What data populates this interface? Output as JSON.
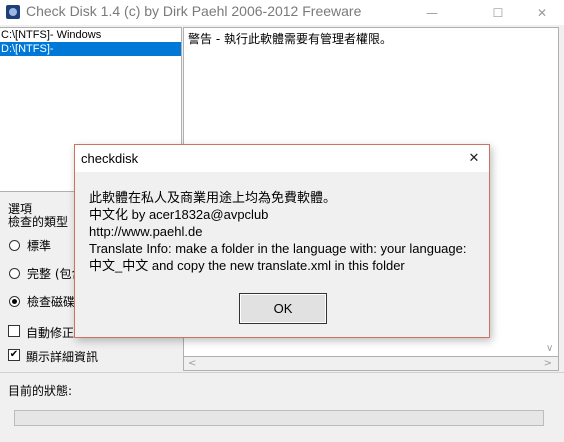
{
  "window": {
    "title": "Check Disk 1.4  (c) by Dirk Paehl  2006-2012 Freeware",
    "minimize_glyph": "—",
    "maximize_glyph": "☐",
    "close_glyph": "✕"
  },
  "drives": [
    {
      "label": "C:\\[NTFS]- Windows",
      "selected": false
    },
    {
      "label": "D:\\[NTFS]-",
      "selected": true
    }
  ],
  "log": {
    "lines": [
      "警告 - 執行此軟體需要有管理者權限。"
    ]
  },
  "options": {
    "title": "選項",
    "subtitle": "檢查的類型",
    "radios": [
      {
        "label": "標準",
        "checked": false
      },
      {
        "label": "完整 (包含",
        "checked": false
      },
      {
        "label": "檢查磁碟",
        "checked": true
      }
    ],
    "checkboxes": [
      {
        "label": "自動修正",
        "checked": false
      },
      {
        "label": "顯示詳細資訊",
        "checked": true
      }
    ]
  },
  "status": {
    "label": "目前的狀態:",
    "progress": 0
  },
  "dialog": {
    "title": "checkdisk",
    "close_glyph": "✕",
    "lines": [
      "此軟體在私人及商業用途上均為免費軟體。",
      "中文化 by acer1832a@avpclub",
      "http://www.paehl.de",
      "Translate Info: make a folder in the language with: your language:",
      "中文_中文 and copy the new translate.xml in this folder"
    ],
    "ok_label": "OK"
  },
  "icons": {
    "app": "disk-icon",
    "radio_dot": "radio-dot",
    "check_mark": "✔"
  }
}
